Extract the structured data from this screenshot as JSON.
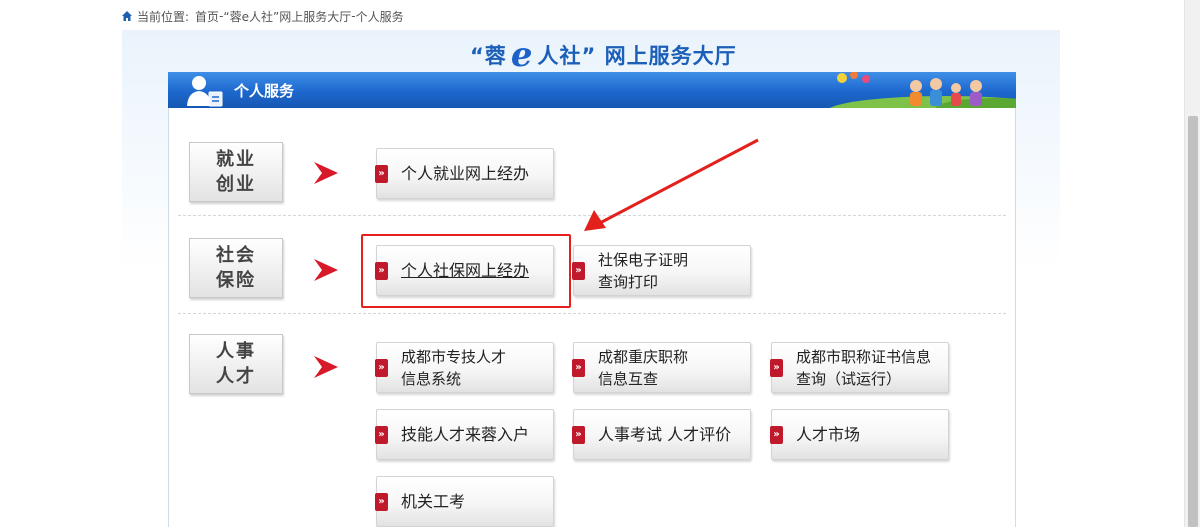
{
  "breadcrumb": {
    "prefix": "当前位置:",
    "home": "首页",
    "sep1": " - ",
    "hall": "“蓉e人社”网上服务大厅",
    "sep2": " - ",
    "current": "个人服务"
  },
  "hall_title": {
    "left": "“蓉",
    "mark": "e",
    "right": "人社” 网上服务大厅"
  },
  "banner": {
    "label": "个人服务"
  },
  "categories": [
    {
      "line1": "就业",
      "line2": "创业"
    },
    {
      "line1": "社会",
      "line2": "保险"
    },
    {
      "line1": "人事",
      "line2": "人才"
    }
  ],
  "services": [
    {
      "label": "个人就业网上经办"
    },
    {
      "label": "个人社保网上经办"
    },
    {
      "label": "社保电子证明\n查询打印"
    },
    {
      "label": "成都市专技人才\n信息系统"
    },
    {
      "label": "成都重庆职称\n信息互查"
    },
    {
      "label": "成都市职称证书信息\n查询（试运行）"
    },
    {
      "label": "技能人才来蓉入户"
    },
    {
      "label": "人事考试  人才评价"
    },
    {
      "label": "人才市场"
    },
    {
      "label": "机关工考"
    }
  ],
  "badge_glyph": "»",
  "colors": {
    "banner_blue": "#1d68cd",
    "title_blue": "#1c5fb8",
    "accent_red": "#c0192c",
    "annotation_red": "#e3201b"
  },
  "icons": {
    "home": "home-icon",
    "user": "user-icon",
    "category_arrow": "red-chevron-right-icon",
    "badge": "double-chevron-icon"
  }
}
